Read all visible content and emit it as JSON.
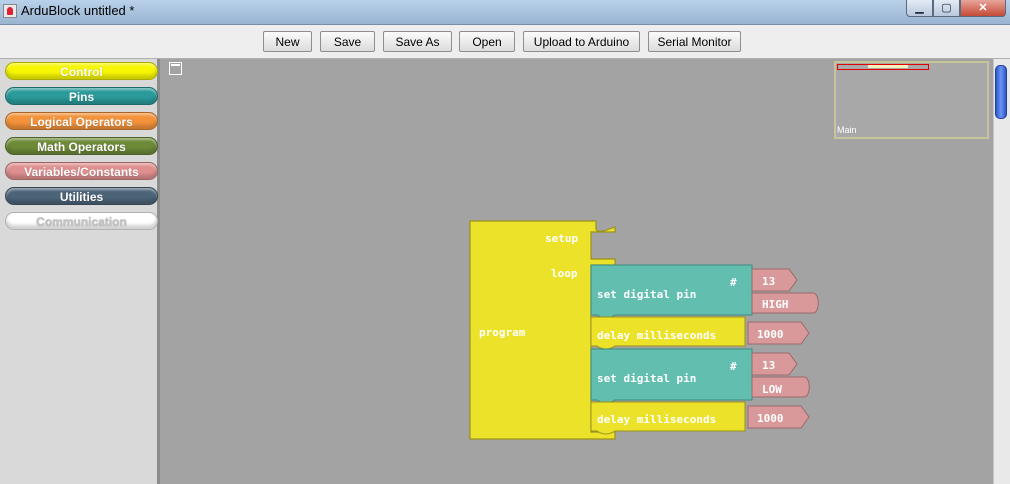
{
  "window": {
    "title": "ArduBlock untitled *",
    "minimize_glyph": "▁",
    "maximize_glyph": "▢",
    "close_glyph": "✕"
  },
  "toolbar": {
    "new_label": "New",
    "save_label": "Save",
    "save_as_label": "Save As",
    "open_label": "Open",
    "upload_label": "Upload to Arduino",
    "serial_label": "Serial Monitor"
  },
  "sidebar": {
    "categories": [
      {
        "label": "Control",
        "color": "#f6f600"
      },
      {
        "label": "Pins",
        "color": "#2a9a9a"
      },
      {
        "label": "Logical Operators",
        "color": "#f3923a"
      },
      {
        "label": "Math Operators",
        "color": "#6d8a38"
      },
      {
        "label": "Variables/Constants",
        "color": "#e08f8f"
      },
      {
        "label": "Utilities",
        "color": "#4c6478"
      },
      {
        "label": "Communication",
        "color": "#ffffff"
      }
    ]
  },
  "minimap": {
    "label": "Main"
  },
  "program_block": {
    "label": "program",
    "setup_label": "setup",
    "loop_label": "loop",
    "color": "#ece22a",
    "statements": [
      {
        "type": "set_digital_pin",
        "label": "set digital pin",
        "hash": "#",
        "pin": "13",
        "value": "HIGH",
        "color": "#62bfb0"
      },
      {
        "type": "delay",
        "label": "delay milliseconds",
        "value": "1000",
        "color": "#ece22a"
      },
      {
        "type": "set_digital_pin",
        "label": "set digital pin",
        "hash": "#",
        "pin": "13",
        "value": "LOW",
        "color": "#62bfb0"
      },
      {
        "type": "delay",
        "label": "delay milliseconds",
        "value": "1000",
        "color": "#ece22a"
      }
    ],
    "value_block_color": "#d9999a"
  }
}
